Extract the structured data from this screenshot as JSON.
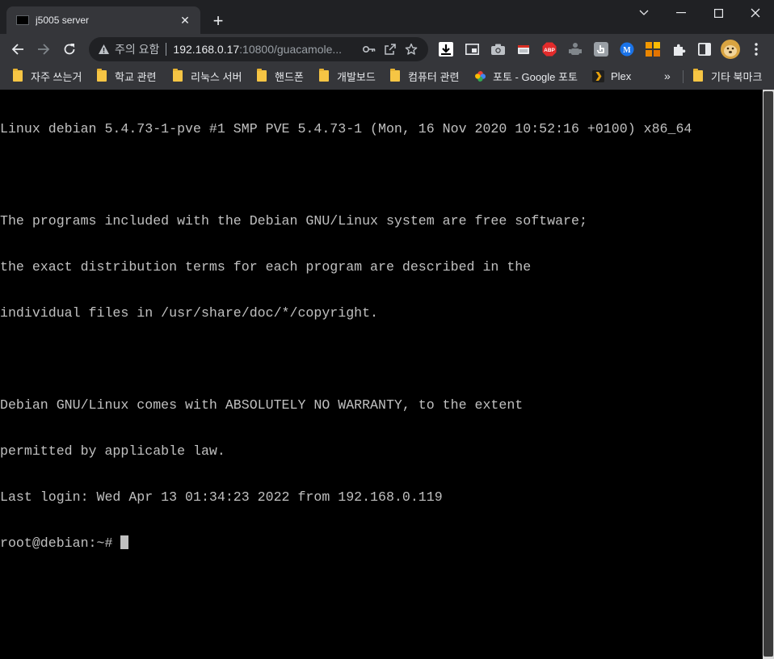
{
  "tab": {
    "title": "j5005 server",
    "close_glyph": "✕",
    "newtab_glyph": "+"
  },
  "window_controls": {
    "tab_search_glyph": "⌄",
    "minimize_glyph": "—",
    "maximize_glyph": "☐",
    "close_glyph": "✕"
  },
  "omnibox": {
    "security_label": "주의 요함",
    "url_host": "192.168.0.17",
    "url_rest": ":10800/guacamole..."
  },
  "extensions": {
    "abp_label": "ABP",
    "m_label": "M"
  },
  "bookmarks": [
    {
      "label": "자주 쓰는거",
      "icon": "folder-icon"
    },
    {
      "label": "학교 관련",
      "icon": "folder-icon"
    },
    {
      "label": "리눅스 서버",
      "icon": "folder-icon"
    },
    {
      "label": "핸드폰",
      "icon": "folder-icon"
    },
    {
      "label": "개발보드",
      "icon": "folder-icon"
    },
    {
      "label": "컴퓨터 관련",
      "icon": "folder-icon"
    },
    {
      "label": "포토 - Google 포토",
      "icon": "google-photos-icon"
    },
    {
      "label": "Plex",
      "icon": "plex-icon"
    }
  ],
  "bookmarks_overflow": "»",
  "other_bookmarks": "기타 북마크",
  "terminal": {
    "lines": [
      "Linux debian 5.4.73-1-pve #1 SMP PVE 5.4.73-1 (Mon, 16 Nov 2020 10:52:16 +0100) x86_64",
      "",
      "The programs included with the Debian GNU/Linux system are free software;",
      "the exact distribution terms for each program are described in the",
      "individual files in /usr/share/doc/*/copyright.",
      "",
      "Debian GNU/Linux comes with ABSOLUTELY NO WARRANTY, to the extent",
      "permitted by applicable law.",
      "Last login: Wed Apr 13 01:34:23 2022 from 192.168.0.119"
    ],
    "prompt": "root@debian:~# "
  }
}
